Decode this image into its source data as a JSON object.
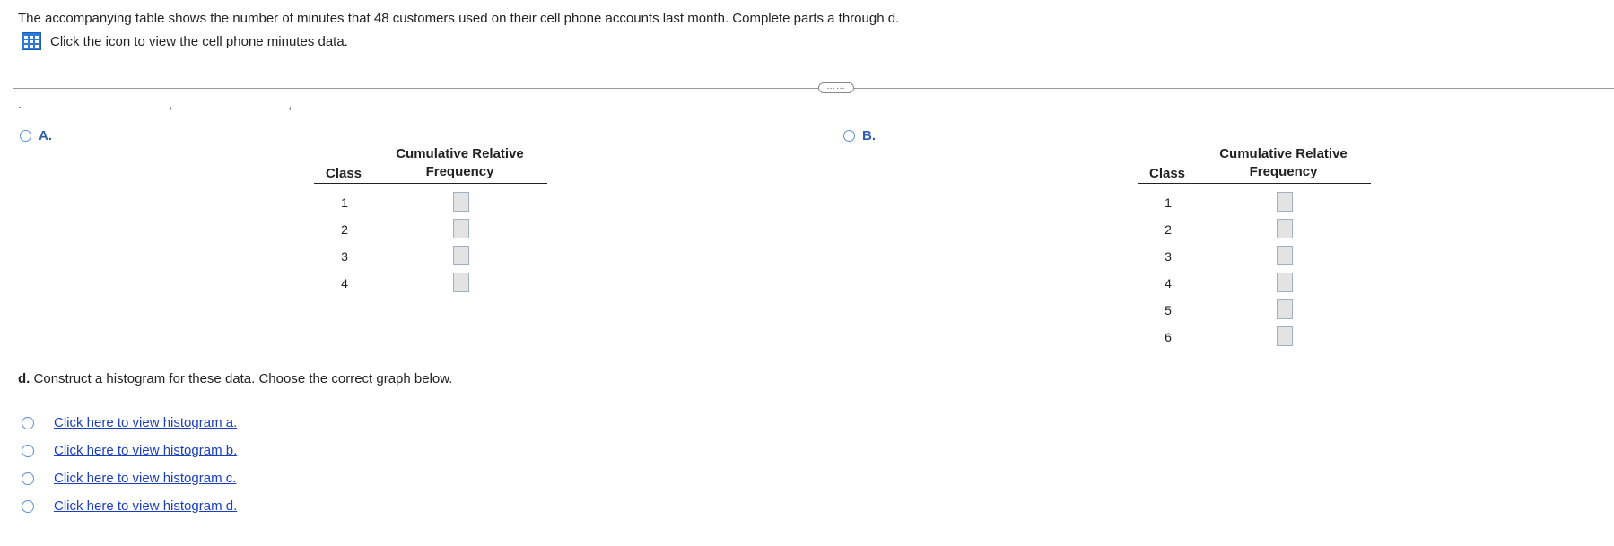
{
  "question": {
    "intro": "The accompanying table shows the number of minutes that 48 customers used on their cell phone accounts last month. Complete parts a through d.",
    "data_link": "Click the icon to view the cell phone minutes data.",
    "data_icon": "grid-data-icon",
    "more_button": "……"
  },
  "ticks": [
    "ˋ",
    "'",
    "′"
  ],
  "options": [
    {
      "letter": "A.",
      "class_header": "Class",
      "freq_header_line1": "Cumulative Relative",
      "freq_header_line2": "Frequency",
      "rows": [
        "1",
        "2",
        "3",
        "4"
      ]
    },
    {
      "letter": "B.",
      "class_header": "Class",
      "freq_header_line1": "Cumulative Relative",
      "freq_header_line2": "Frequency",
      "rows": [
        "1",
        "2",
        "3",
        "4",
        "5",
        "6"
      ]
    }
  ],
  "part_d": {
    "label": "d.",
    "text": "Construct a histogram for these data. Choose the correct graph below.",
    "histograms": [
      "Click here to view histogram a.",
      "Click here to view histogram b.",
      "Click here to view histogram c.",
      "Click here to view histogram d."
    ]
  },
  "colors": {
    "radio_border": "#5b8fd6",
    "link": "#1a3fc0",
    "option_letter": "#2f5da8",
    "input_cell_bg": "#e3e3e3"
  }
}
